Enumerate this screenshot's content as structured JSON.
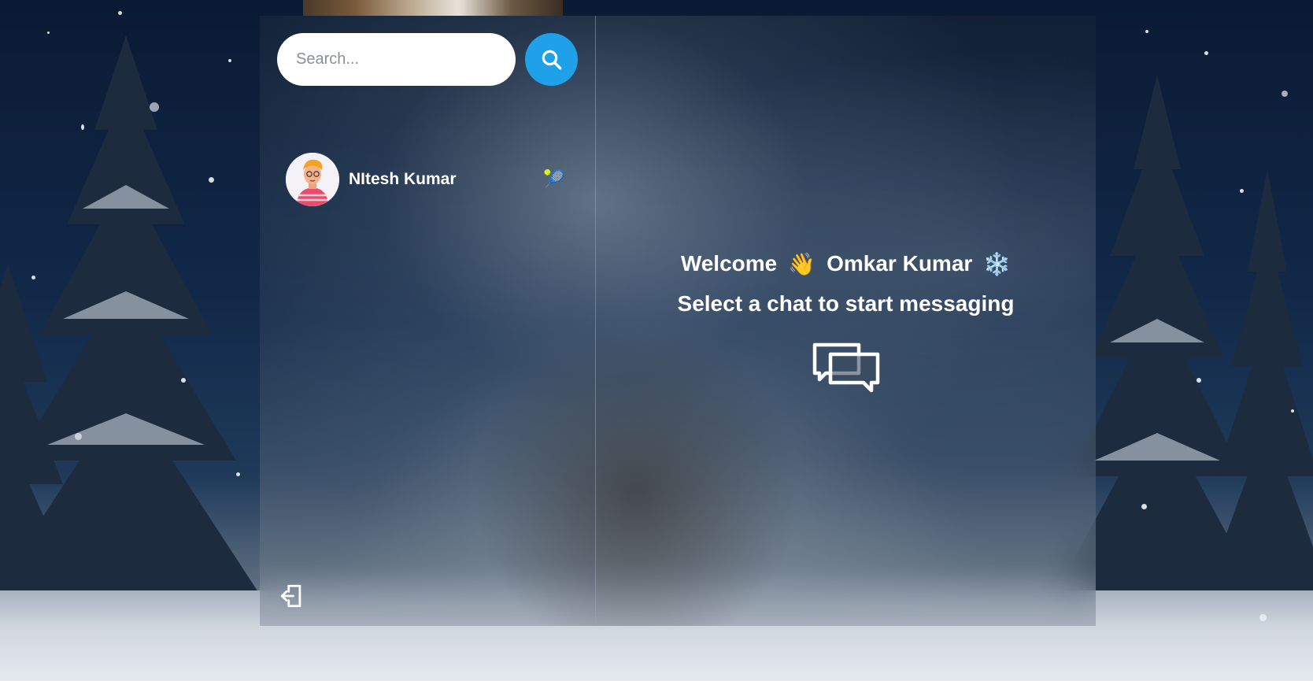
{
  "search": {
    "placeholder": "Search..."
  },
  "conversations": [
    {
      "name": "NItesh Kumar",
      "emoji": "🎾"
    }
  ],
  "welcome": {
    "greeting": "Welcome",
    "wave_emoji": "👋",
    "user_name": "Omkar Kumar",
    "snow_emoji": "❄️",
    "prompt": "Select a chat to start messaging"
  },
  "icons": {
    "search": "search-icon",
    "logout": "logout-icon",
    "chat": "chat-bubbles-icon"
  },
  "colors": {
    "accent": "#1ea1e8",
    "text": "#ffffff"
  }
}
